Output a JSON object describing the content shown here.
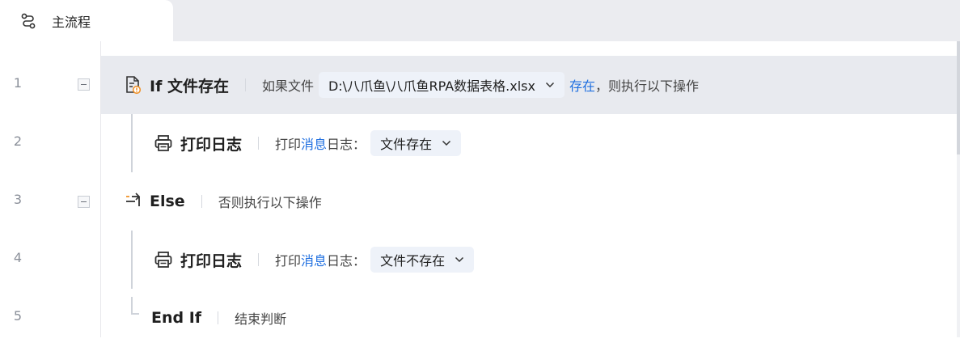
{
  "tab": {
    "label": "主流程",
    "icon": "flow-icon"
  },
  "line_numbers": [
    "1",
    "2",
    "3",
    "4",
    "5"
  ],
  "rows": [
    {
      "command": "If 文件存在",
      "icon": "file-check-icon",
      "desc_prefix": "如果文件",
      "file_path": "D:\\八爪鱼\\八爪鱼RPA数据表格.xlsx",
      "link_text": "存在",
      "desc_suffix": "，则执行以下操作"
    },
    {
      "command": "打印日志",
      "icon": "printer-icon",
      "desc_prefix": "打印",
      "link_text": "消息",
      "desc_suffix": "日志：",
      "value": "文件存在"
    },
    {
      "command": "Else",
      "icon": "branch-icon",
      "desc": "否则执行以下操作"
    },
    {
      "command": "打印日志",
      "icon": "printer-icon",
      "desc_prefix": "打印",
      "link_text": "消息",
      "desc_suffix": "日志：",
      "value": "文件不存在"
    },
    {
      "command": "End If",
      "desc": "结束判断"
    }
  ],
  "colors": {
    "link": "#1f6fe0",
    "active_row": "#e8eaef",
    "tab_bar": "#ebecf0",
    "pill": "#eef2f9",
    "warn": "#f0932b"
  }
}
